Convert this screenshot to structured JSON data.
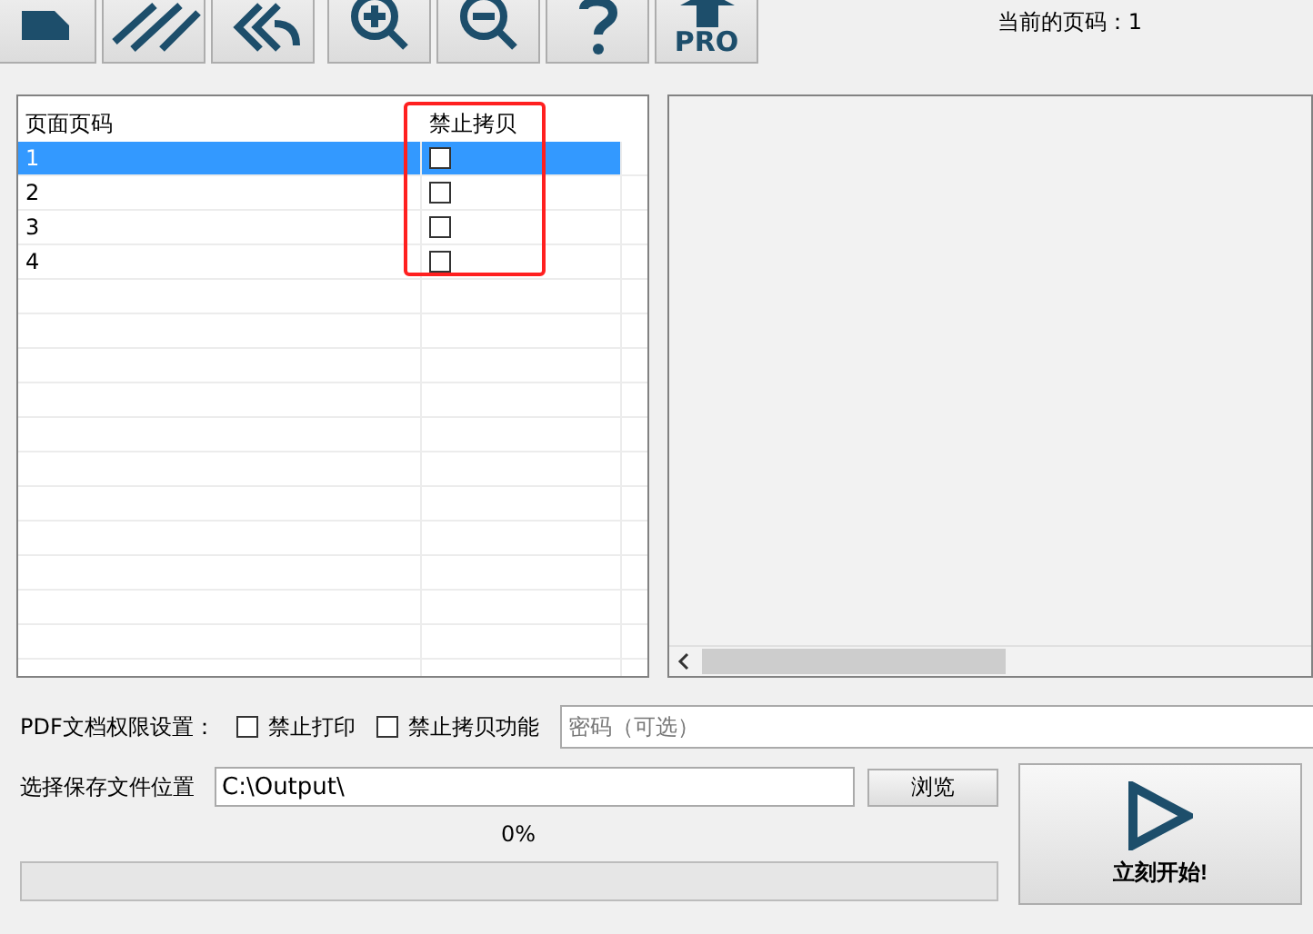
{
  "toolbar": {
    "pro_label": "PRO"
  },
  "current_page": "当前的页码：1",
  "table": {
    "columns": [
      "页面页码",
      "禁止拷贝"
    ],
    "rows": [
      {
        "page": "1",
        "copy_protected": false,
        "selected": true
      },
      {
        "page": "2",
        "copy_protected": false,
        "selected": false
      },
      {
        "page": "3",
        "copy_protected": false,
        "selected": false
      },
      {
        "page": "4",
        "copy_protected": false,
        "selected": false
      }
    ]
  },
  "permissions": {
    "label": "PDF文档权限设置：",
    "options": [
      {
        "label": "禁止打印",
        "checked": false
      },
      {
        "label": "禁止拷贝功能",
        "checked": false
      }
    ],
    "password": {
      "placeholder": "密码（可选）"
    }
  },
  "output": {
    "label": "选择保存文件位置",
    "path": "C:\\Output\\",
    "browse": "浏览"
  },
  "progress": {
    "reading": "0%",
    "level": 0
  },
  "start_button": {
    "label": "立刻开始!"
  }
}
